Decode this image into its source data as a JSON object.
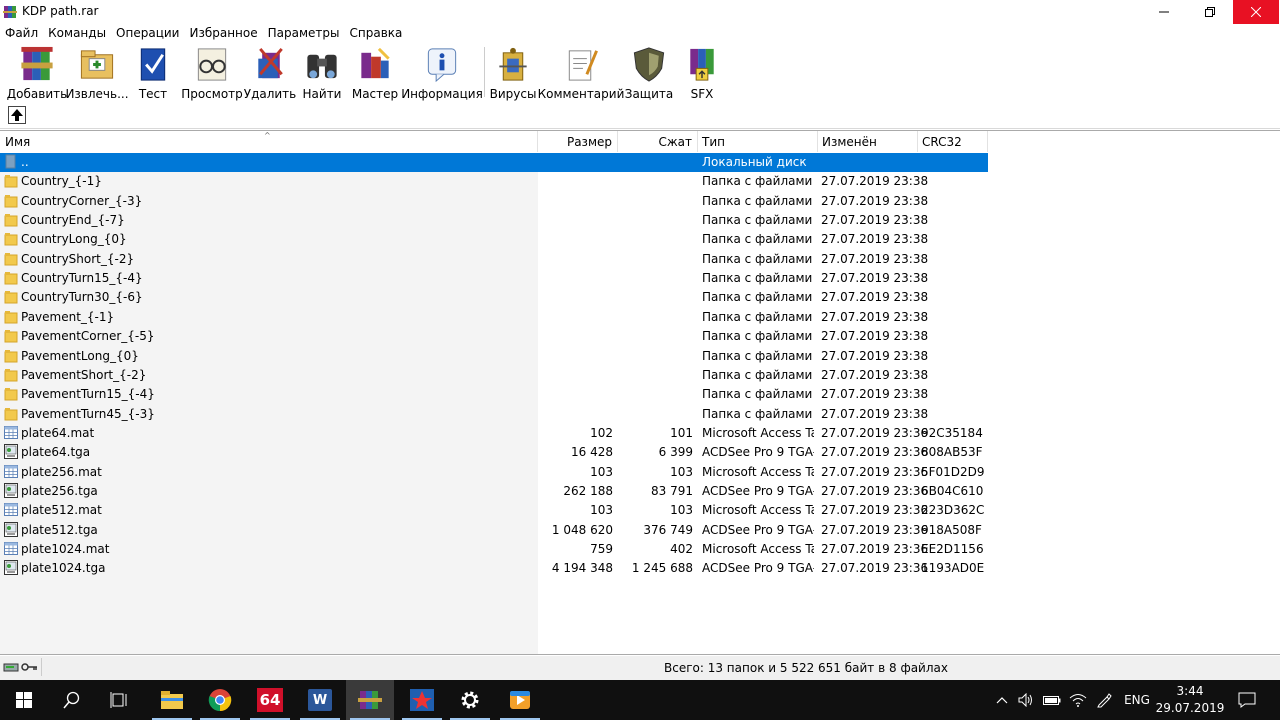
{
  "window": {
    "title": "KDP path.rar"
  },
  "menu": [
    "Файл",
    "Команды",
    "Операции",
    "Избранное",
    "Параметры",
    "Справка"
  ],
  "toolbar": [
    {
      "label": "Добавить",
      "icon": "add-books-icon"
    },
    {
      "label": "Извлечь...",
      "icon": "extract-folder-icon"
    },
    {
      "label": "Тест",
      "icon": "test-book-icon"
    },
    {
      "label": "Просмотр",
      "icon": "view-glasses-icon"
    },
    {
      "label": "Удалить",
      "icon": "delete-icon"
    },
    {
      "label": "Найти",
      "icon": "binoculars-icon"
    },
    {
      "label": "Мастер",
      "icon": "wizard-icon"
    },
    {
      "label": "Информация",
      "icon": "info-icon"
    },
    {
      "label": "Вирусы",
      "icon": "virus-scan-icon"
    },
    {
      "label": "Комментарий",
      "icon": "comment-icon"
    },
    {
      "label": "Защита",
      "icon": "shield-icon"
    },
    {
      "label": "SFX",
      "icon": "sfx-icon"
    }
  ],
  "columns": {
    "name": "Имя",
    "size": "Размер",
    "packed": "Сжат",
    "type": "Тип",
    "modified": "Изменён",
    "crc": "CRC32"
  },
  "rows": [
    {
      "name": "..",
      "size": "",
      "packed": "",
      "type": "Локальный диск",
      "modified": "",
      "crc": "",
      "kind": "up",
      "selected": true
    },
    {
      "name": "Country_{-1}",
      "size": "",
      "packed": "",
      "type": "Папка с файлами",
      "modified": "27.07.2019 23:38",
      "crc": "",
      "kind": "folder"
    },
    {
      "name": "CountryCorner_{-3}",
      "size": "",
      "packed": "",
      "type": "Папка с файлами",
      "modified": "27.07.2019 23:38",
      "crc": "",
      "kind": "folder"
    },
    {
      "name": "CountryEnd_{-7}",
      "size": "",
      "packed": "",
      "type": "Папка с файлами",
      "modified": "27.07.2019 23:38",
      "crc": "",
      "kind": "folder"
    },
    {
      "name": "CountryLong_{0}",
      "size": "",
      "packed": "",
      "type": "Папка с файлами",
      "modified": "27.07.2019 23:38",
      "crc": "",
      "kind": "folder"
    },
    {
      "name": "CountryShort_{-2}",
      "size": "",
      "packed": "",
      "type": "Папка с файлами",
      "modified": "27.07.2019 23:38",
      "crc": "",
      "kind": "folder"
    },
    {
      "name": "CountryTurn15_{-4}",
      "size": "",
      "packed": "",
      "type": "Папка с файлами",
      "modified": "27.07.2019 23:38",
      "crc": "",
      "kind": "folder"
    },
    {
      "name": "CountryTurn30_{-6}",
      "size": "",
      "packed": "",
      "type": "Папка с файлами",
      "modified": "27.07.2019 23:38",
      "crc": "",
      "kind": "folder"
    },
    {
      "name": "Pavement_{-1}",
      "size": "",
      "packed": "",
      "type": "Папка с файлами",
      "modified": "27.07.2019 23:38",
      "crc": "",
      "kind": "folder"
    },
    {
      "name": "PavementCorner_{-5}",
      "size": "",
      "packed": "",
      "type": "Папка с файлами",
      "modified": "27.07.2019 23:38",
      "crc": "",
      "kind": "folder"
    },
    {
      "name": "PavementLong_{0}",
      "size": "",
      "packed": "",
      "type": "Папка с файлами",
      "modified": "27.07.2019 23:38",
      "crc": "",
      "kind": "folder"
    },
    {
      "name": "PavementShort_{-2}",
      "size": "",
      "packed": "",
      "type": "Папка с файлами",
      "modified": "27.07.2019 23:38",
      "crc": "",
      "kind": "folder"
    },
    {
      "name": "PavementTurn15_{-4}",
      "size": "",
      "packed": "",
      "type": "Папка с файлами",
      "modified": "27.07.2019 23:38",
      "crc": "",
      "kind": "folder"
    },
    {
      "name": "PavementTurn45_{-3}",
      "size": "",
      "packed": "",
      "type": "Папка с файлами",
      "modified": "27.07.2019 23:38",
      "crc": "",
      "kind": "folder"
    },
    {
      "name": "plate64.mat",
      "size": "102",
      "packed": "101",
      "type": "Microsoft Access Ta...",
      "modified": "27.07.2019 23:36",
      "crc": "92C35184",
      "kind": "mat"
    },
    {
      "name": "plate64.tga",
      "size": "16 428",
      "packed": "6 399",
      "type": "ACDSee Pro 9 TGA-...",
      "modified": "27.07.2019 23:36",
      "crc": "808AB53F",
      "kind": "tga"
    },
    {
      "name": "plate256.mat",
      "size": "103",
      "packed": "103",
      "type": "Microsoft Access Ta...",
      "modified": "27.07.2019 23:36",
      "crc": "5F01D2D9",
      "kind": "mat"
    },
    {
      "name": "plate256.tga",
      "size": "262 188",
      "packed": "83 791",
      "type": "ACDSee Pro 9 TGA-...",
      "modified": "27.07.2019 23:36",
      "crc": "6B04C610",
      "kind": "tga"
    },
    {
      "name": "plate512.mat",
      "size": "103",
      "packed": "103",
      "type": "Microsoft Access Ta...",
      "modified": "27.07.2019 23:36",
      "crc": "223D362C",
      "kind": "mat"
    },
    {
      "name": "plate512.tga",
      "size": "1 048 620",
      "packed": "376 749",
      "type": "ACDSee Pro 9 TGA-...",
      "modified": "27.07.2019 23:36",
      "crc": "918A508F",
      "kind": "tga"
    },
    {
      "name": "plate1024.mat",
      "size": "759",
      "packed": "402",
      "type": "Microsoft Access Ta...",
      "modified": "27.07.2019 23:36",
      "crc": "EE2D1156",
      "kind": "mat"
    },
    {
      "name": "plate1024.tga",
      "size": "4 194 348",
      "packed": "1 245 688",
      "type": "ACDSee Pro 9 TGA-...",
      "modified": "27.07.2019 23:36",
      "crc": "1193AD0E",
      "kind": "tga"
    }
  ],
  "status": {
    "summary": "Всего: 13 папок и 5 522 651 байт в 8 файлах"
  },
  "taskbar": {
    "apps": [
      "start-icon",
      "search-icon",
      "task-view-icon",
      "file-explorer-icon",
      "chrome-icon",
      "aida64-icon",
      "word-icon",
      "winrar-icon",
      "media-app-icon",
      "settings-icon",
      "video-player-icon"
    ],
    "language": "ENG",
    "time": "3:44",
    "date": "29.07.2019",
    "badge_64": "64",
    "word_letter": "W"
  },
  "colors": {
    "selection": "#0078d7",
    "close_button": "#e81123",
    "taskbar": "#101010"
  }
}
